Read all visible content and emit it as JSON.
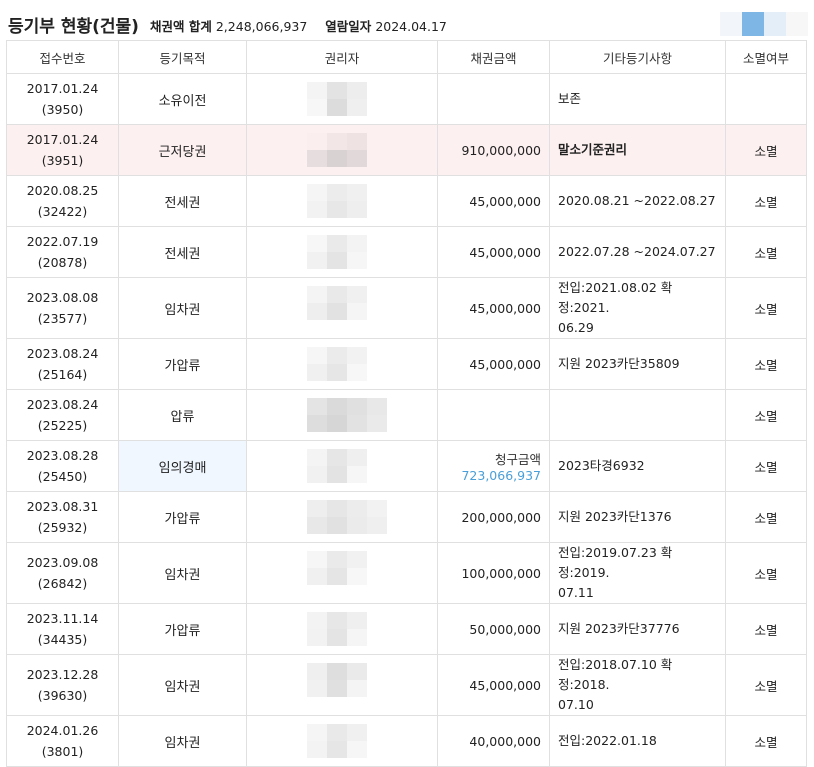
{
  "header": {
    "title": "등기부 현황(건물)",
    "sum_label": "채권액 합계",
    "sum_value": "2,248,066,937",
    "date_label": "열람일자",
    "date_value": "2024.04.17"
  },
  "columns": [
    "접수번호",
    "등기목적",
    "권리자",
    "채권금액",
    "기타등기사항",
    "소멸여부"
  ],
  "rows": [
    {
      "date": "2017.01.24",
      "num": "(3950)",
      "purpose": "소유이전",
      "amount": "",
      "etc": "보존",
      "status": ""
    },
    {
      "date": "2017.01.24",
      "num": "(3951)",
      "purpose": "근저당권",
      "amount": "910,000,000",
      "etc": "말소기준권리",
      "status": "소멸"
    },
    {
      "date": "2020.08.25",
      "num": "(32422)",
      "purpose": "전세권",
      "amount": "45,000,000",
      "etc": "2020.08.21 ~2022.08.27",
      "status": "소멸"
    },
    {
      "date": "2022.07.19",
      "num": "(20878)",
      "purpose": "전세권",
      "amount": "45,000,000",
      "etc": "2022.07.28 ~2024.07.27",
      "status": "소멸"
    },
    {
      "date": "2023.08.08",
      "num": "(23577)",
      "purpose": "임차권",
      "amount": "45,000,000",
      "etc": "전입:2021.08.02 확정:2021.",
      "etc2": "06.29",
      "status": "소멸"
    },
    {
      "date": "2023.08.24",
      "num": "(25164)",
      "purpose": "가압류",
      "amount": "45,000,000",
      "etc": "지원 2023카단35809",
      "status": "소멸"
    },
    {
      "date": "2023.08.24",
      "num": "(25225)",
      "purpose": "압류",
      "amount": "",
      "etc": "",
      "status": "소멸"
    },
    {
      "date": "2023.08.28",
      "num": "(25450)",
      "purpose": "임의경매",
      "amount_label": "청구금액",
      "amount_value": "723,066,937",
      "etc": "2023타경6932",
      "status": "소멸"
    },
    {
      "date": "2023.08.31",
      "num": "(25932)",
      "purpose": "가압류",
      "amount": "200,000,000",
      "etc": "지원 2023카단1376",
      "status": "소멸"
    },
    {
      "date": "2023.09.08",
      "num": "(26842)",
      "purpose": "임차권",
      "amount": "100,000,000",
      "etc": "전입:2019.07.23 확정:2019.",
      "etc2": "07.11",
      "status": "소멸"
    },
    {
      "date": "2023.11.14",
      "num": "(34435)",
      "purpose": "가압류",
      "amount": "50,000,000",
      "etc": "지원 2023카단37776",
      "status": "소멸"
    },
    {
      "date": "2023.12.28",
      "num": "(39630)",
      "purpose": "임차권",
      "amount": "45,000,000",
      "etc": "전입:2018.07.10 확정:2018.",
      "etc2": "07.10",
      "status": "소멸"
    },
    {
      "date": "2024.01.26",
      "num": "(3801)",
      "purpose": "임차권",
      "amount": "40,000,000",
      "etc": "전입:2022.01.18",
      "status": "소멸"
    }
  ]
}
